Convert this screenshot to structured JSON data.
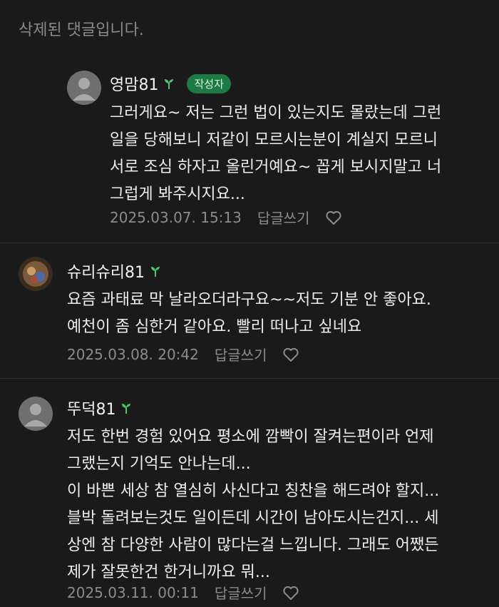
{
  "deleted_notice": "삭제된 댓글입니다.",
  "comments": [
    {
      "author": "영맘81",
      "badge": "작성자",
      "lines": [
        "그러게요~ 저는 그런 법이 있는지도 몰랐는데 그런",
        "일을 당해보니 저같이 모르시는분이 계실지 모르니",
        "서로 조심 하자고 올린거예요~ 꼽게 보시지말고 너",
        "그럽게 봐주시지요..."
      ],
      "date": "2025.03.07. 15:13",
      "reply_label": "답글쓰기"
    },
    {
      "author": "슈리슈리81",
      "lines": [
        "요즘 과태료 막 날라오더라구요~~저도 기분 안 좋아요.",
        "예천이 좀 심한거 같아요. 빨리 떠나고 싶네요"
      ],
      "date": "2025.03.08. 20:42",
      "reply_label": "답글쓰기"
    },
    {
      "author": "뚜덕81",
      "lines": [
        "저도 한번 경험 있어요 평소에 깜빡이 잘켜는편이라 언제",
        "그랬는지 기억도 안나는데...",
        "이 바쁜 세상 참 열심히 사신다고 칭찬을 해드려야 할지...",
        "블박 돌려보는것도 일이든데 시간이 남아도시는건지... 세",
        "상엔 참 다양한 사람이 많다는걸 느낍니다. 그래도 어쨌든",
        "제가 잘못한건 한거니까요 뭐..."
      ],
      "date": "2025.03.11. 00:11",
      "reply_label": "답글쓰기"
    }
  ],
  "icons": {
    "sprout": "sprout-icon",
    "heart": "heart-icon",
    "avatar": "default-avatar-icon"
  },
  "colors": {
    "background": "#1a1a1a",
    "badge": "#1e7a43",
    "sprout": "#4cc46a"
  }
}
